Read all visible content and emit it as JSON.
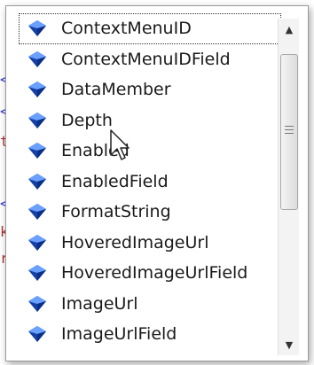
{
  "popup": {
    "items": [
      {
        "label": "ContextMenuID",
        "icon": "property-icon",
        "selected": true
      },
      {
        "label": "ContextMenuIDField",
        "icon": "property-icon"
      },
      {
        "label": "DataMember",
        "icon": "property-icon"
      },
      {
        "label": "Depth",
        "icon": "property-icon"
      },
      {
        "label": "Enabled",
        "icon": "property-icon"
      },
      {
        "label": "EnabledField",
        "icon": "property-icon"
      },
      {
        "label": "FormatString",
        "icon": "property-icon"
      },
      {
        "label": "HoveredImageUrl",
        "icon": "property-icon"
      },
      {
        "label": "HoveredImageUrlField",
        "icon": "property-icon"
      },
      {
        "label": "ImageUrl",
        "icon": "property-icon"
      },
      {
        "label": "ImageUrlField",
        "icon": "property-icon"
      }
    ]
  },
  "scrollbar": {
    "up_arrow": "▲",
    "down_arrow": "▼",
    "position_fraction": 0.0
  },
  "colors": {
    "icon_light": "#6aa0ff",
    "icon_dark": "#1440a8",
    "text": "#1a1a1a",
    "border": "#9a9a9a"
  }
}
